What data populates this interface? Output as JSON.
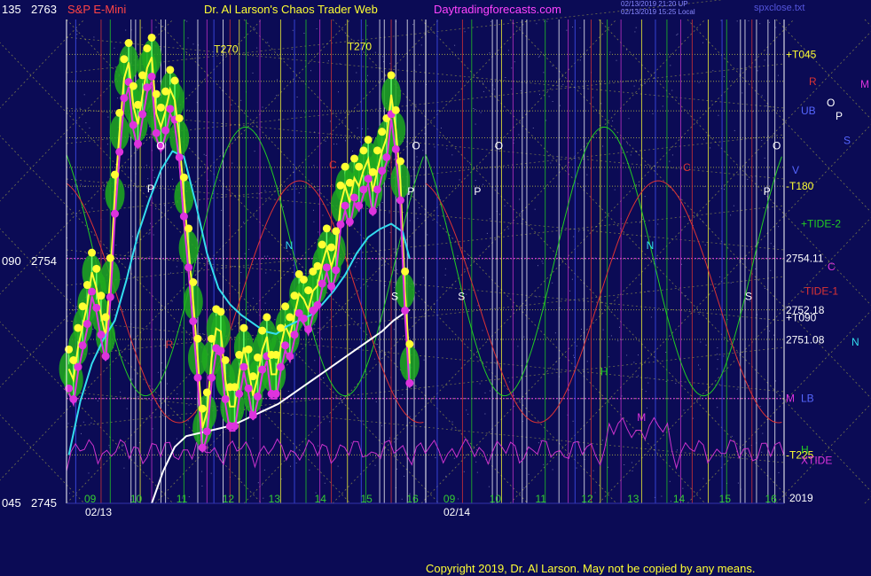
{
  "header": {
    "symbol_row": "135",
    "symbol_price": "2763",
    "symbol": "S&P E-Mini",
    "author": "Dr. Al Larson's Chaos Trader Web",
    "site": "Daytradingforecasts.com",
    "stamp1": "02/13/2019 21:20 UP",
    "stamp2": "02/13/2019 15:25 Local",
    "file": "spxclose.txt"
  },
  "copyright": "Copyright 2019, Dr. Al Larson. May not be copied by any means.",
  "colors": {
    "background": "#0b0b55",
    "grid_yellow": "#cccc44",
    "grid_pink": "#e040e0",
    "cyan": "#33ddee",
    "yellow": "#ffff33",
    "green": "#22cc22",
    "magenta": "#dd33dd",
    "white": "#ffffff",
    "red": "#dd3333",
    "axis_text": "#ffffff"
  },
  "chart_data": {
    "type": "line",
    "title": "S&P E-Mini",
    "ylim": [
      2745,
      2763
    ],
    "y_ticks": [
      {
        "row": "135",
        "value": "2763"
      },
      {
        "row": "090",
        "value": "2754"
      },
      {
        "row": "045",
        "value": "2745"
      }
    ],
    "x_date_labels": [
      "02/13",
      "02/14"
    ],
    "x_hour_labels_day1": [
      "09",
      "10",
      "11",
      "12",
      "13",
      "14",
      "15",
      "16"
    ],
    "x_hour_labels_day2": [
      "09",
      "10",
      "11",
      "12",
      "13",
      "14",
      "15",
      "16"
    ],
    "x_range_hours": [
      8.5,
      16.3
    ],
    "series": [
      {
        "name": "price",
        "color": "yellow",
        "x": [
          8.55,
          8.65,
          8.75,
          8.85,
          8.95,
          9.05,
          9.15,
          9.25,
          9.35,
          9.45,
          9.55,
          9.65,
          9.75,
          9.85,
          9.95,
          10.05,
          10.15,
          10.25,
          10.35,
          10.45,
          10.55,
          10.65,
          10.75,
          10.85,
          10.95,
          11.05,
          11.15,
          11.25,
          11.35,
          11.45,
          11.55,
          11.65,
          11.75,
          11.85,
          11.95,
          12.05,
          12.15,
          12.25,
          12.35,
          12.45,
          12.55,
          12.65,
          12.75,
          12.85,
          12.95,
          13.05,
          13.15,
          13.25,
          13.35,
          13.45,
          13.55,
          13.65,
          13.75,
          13.85,
          13.95,
          14.05,
          14.15,
          14.25,
          14.35,
          14.45,
          14.55,
          14.65,
          14.75,
          14.85,
          14.95,
          15.05,
          15.15,
          15.25,
          15.35,
          15.45,
          15.55,
          15.65,
          15.75,
          15.85,
          15.95
        ],
        "y": [
          2750.0,
          2749.6,
          2750.8,
          2751.6,
          2752.4,
          2753.6,
          2753.0,
          2752.0,
          2751.2,
          2753.4,
          2756.5,
          2758.8,
          2760.8,
          2761.4,
          2759.8,
          2759.1,
          2760.2,
          2761.2,
          2761.6,
          2759.5,
          2759.0,
          2759.6,
          2760.4,
          2760.0,
          2758.6,
          2756.4,
          2754.5,
          2752.5,
          2750.4,
          2747.8,
          2748.4,
          2750.4,
          2751.5,
          2751.4,
          2749.6,
          2748.6,
          2748.6,
          2749.8,
          2750.8,
          2750.0,
          2749.0,
          2749.7,
          2750.7,
          2751.2,
          2749.8,
          2749.8,
          2750.8,
          2751.6,
          2751.2,
          2752.0,
          2752.8,
          2752.6,
          2752.2,
          2752.9,
          2753.1,
          2753.9,
          2754.5,
          2753.8,
          2754.4,
          2756.1,
          2756.8,
          2756.2,
          2757.1,
          2756.8,
          2757.4,
          2757.8,
          2756.6,
          2757.4,
          2758.1,
          2758.6,
          2760.2,
          2758.9,
          2757.0,
          2752.9,
          2750.2
        ]
      },
      {
        "name": "fast average",
        "color": "cyan",
        "x": [
          8.55,
          8.8,
          9.05,
          9.3,
          9.55,
          9.8,
          10.05,
          10.3,
          10.55,
          10.8,
          11.05,
          11.3,
          11.55,
          11.8,
          12.05,
          12.3,
          12.55,
          12.8,
          13.05,
          13.3,
          13.55,
          13.8,
          14.05,
          14.3,
          14.55,
          14.8,
          15.05,
          15.3,
          15.55,
          15.8,
          15.95
        ],
        "y": [
          2746.8,
          2748.8,
          2750.2,
          2751.1,
          2751.8,
          2753.3,
          2755.0,
          2756.3,
          2757.4,
          2758.1,
          2757.9,
          2756.2,
          2754.3,
          2753.0,
          2752.4,
          2752.0,
          2751.7,
          2751.4,
          2751.3,
          2751.6,
          2751.8,
          2752.0,
          2752.4,
          2752.9,
          2753.5,
          2754.3,
          2754.9,
          2755.2,
          2755.4,
          2755.1,
          2754.1
        ]
      },
      {
        "name": "slow average",
        "color": "white",
        "x": [
          10.35,
          10.6,
          10.85,
          11.1,
          11.35,
          11.6,
          11.85,
          12.1,
          12.35,
          12.6,
          12.85,
          13.1,
          13.35,
          13.6,
          13.85,
          14.1,
          14.35,
          14.6,
          14.85,
          15.1,
          15.35,
          15.6,
          15.85,
          15.95
        ],
        "y": [
          2745.0,
          2746.2,
          2747.1,
          2747.5,
          2747.6,
          2747.7,
          2747.8,
          2747.9,
          2748.1,
          2748.3,
          2748.5,
          2748.7,
          2749.0,
          2749.3,
          2749.6,
          2749.9,
          2750.2,
          2750.5,
          2750.8,
          2751.1,
          2751.4,
          2751.8,
          2752.1,
          2752.2
        ]
      }
    ],
    "right_labels": [
      {
        "text": "+T045",
        "value": 2761.7,
        "color": "yellow"
      },
      {
        "text": "R",
        "value": 2760.7,
        "color": "red"
      },
      {
        "text": "M",
        "value": 2760.6,
        "color": "magenta"
      },
      {
        "text": "O",
        "value": 2759.9,
        "color": "white"
      },
      {
        "text": "UB",
        "value": 2759.6,
        "color": "blue"
      },
      {
        "text": "P",
        "value": 2759.4,
        "color": "white"
      },
      {
        "text": "S",
        "value": 2758.5,
        "color": "blue"
      },
      {
        "text": "V",
        "value": 2757.4,
        "color": "blue"
      },
      {
        "text": "-T180",
        "value": 2756.8,
        "color": "yellow"
      },
      {
        "text": "+TIDE-2",
        "value": 2755.4,
        "color": "green"
      },
      {
        "text": "2754.11",
        "value": 2754.11,
        "color": "white"
      },
      {
        "text": "C",
        "value": 2753.8,
        "color": "magenta"
      },
      {
        "text": "-TIDE-1",
        "value": 2752.9,
        "color": "red"
      },
      {
        "text": "2752.18",
        "value": 2752.18,
        "color": "white"
      },
      {
        "text": "+T090",
        "value": 2751.9,
        "color": "white"
      },
      {
        "text": "2751.08",
        "value": 2751.08,
        "color": "white"
      },
      {
        "text": "N",
        "value": 2751.0,
        "color": "cyan"
      },
      {
        "text": "M",
        "value": 2748.9,
        "color": "magenta"
      },
      {
        "text": "LB",
        "value": 2748.9,
        "color": "blue"
      },
      {
        "text": "-T225",
        "value": 2746.8,
        "color": "yellow"
      },
      {
        "text": "H",
        "value": 2747.0,
        "color": "green"
      },
      {
        "text": "XTIDE",
        "value": 2746.6,
        "color": "magenta"
      },
      {
        "text": "2019",
        "value": 2745.2,
        "color": "white"
      }
    ],
    "chart_letters": [
      {
        "text": "T270",
        "x": 11.7,
        "y": 2761.9,
        "color": "yellow"
      },
      {
        "text": "T270",
        "x": 14.6,
        "y": 2762.0,
        "color": "yellow"
      },
      {
        "text": "O",
        "x": 10.45,
        "y": 2758.3,
        "color": "white"
      },
      {
        "text": "P",
        "x": 10.25,
        "y": 2756.7,
        "color": "white"
      },
      {
        "text": "N",
        "x": 13.25,
        "y": 2754.6,
        "color": "cyan"
      },
      {
        "text": "C",
        "x": 14.2,
        "y": 2757.6,
        "color": "red"
      },
      {
        "text": "O",
        "x": 16.0,
        "y": 2758.3,
        "color": "white"
      },
      {
        "text": "P",
        "x": 15.9,
        "y": 2756.6,
        "color": "white"
      },
      {
        "text": "S",
        "x": 15.55,
        "y": 2752.7,
        "color": "white"
      },
      {
        "text": "R",
        "x": 10.65,
        "y": 2750.9,
        "color": "red"
      },
      {
        "text": "M",
        "x": 12.45,
        "y": 2748.3,
        "color": "magenta"
      },
      {
        "text": "O",
        "x": 10.0,
        "y": 2758.3,
        "color": "white",
        "day": 2
      },
      {
        "text": "P",
        "x": 9.55,
        "y": 2756.6,
        "color": "white",
        "day": 2
      },
      {
        "text": "S",
        "x": 9.2,
        "y": 2752.7,
        "color": "white",
        "day": 2
      },
      {
        "text": "C",
        "x": 14.1,
        "y": 2757.5,
        "color": "red",
        "day": 2
      },
      {
        "text": "N",
        "x": 13.3,
        "y": 2754.6,
        "color": "cyan",
        "day": 2
      },
      {
        "text": "H",
        "x": 12.3,
        "y": 2749.9,
        "color": "green",
        "day": 2
      },
      {
        "text": "M",
        "x": 13.1,
        "y": 2748.2,
        "color": "magenta",
        "day": 2
      },
      {
        "text": "O",
        "x": 16.05,
        "y": 2758.3,
        "color": "white",
        "day": 2
      },
      {
        "text": "P",
        "x": 15.85,
        "y": 2756.6,
        "color": "white",
        "day": 2
      },
      {
        "text": "S",
        "x": 15.45,
        "y": 2752.7,
        "color": "white",
        "day": 2
      }
    ],
    "grid": true,
    "legend": "none"
  }
}
